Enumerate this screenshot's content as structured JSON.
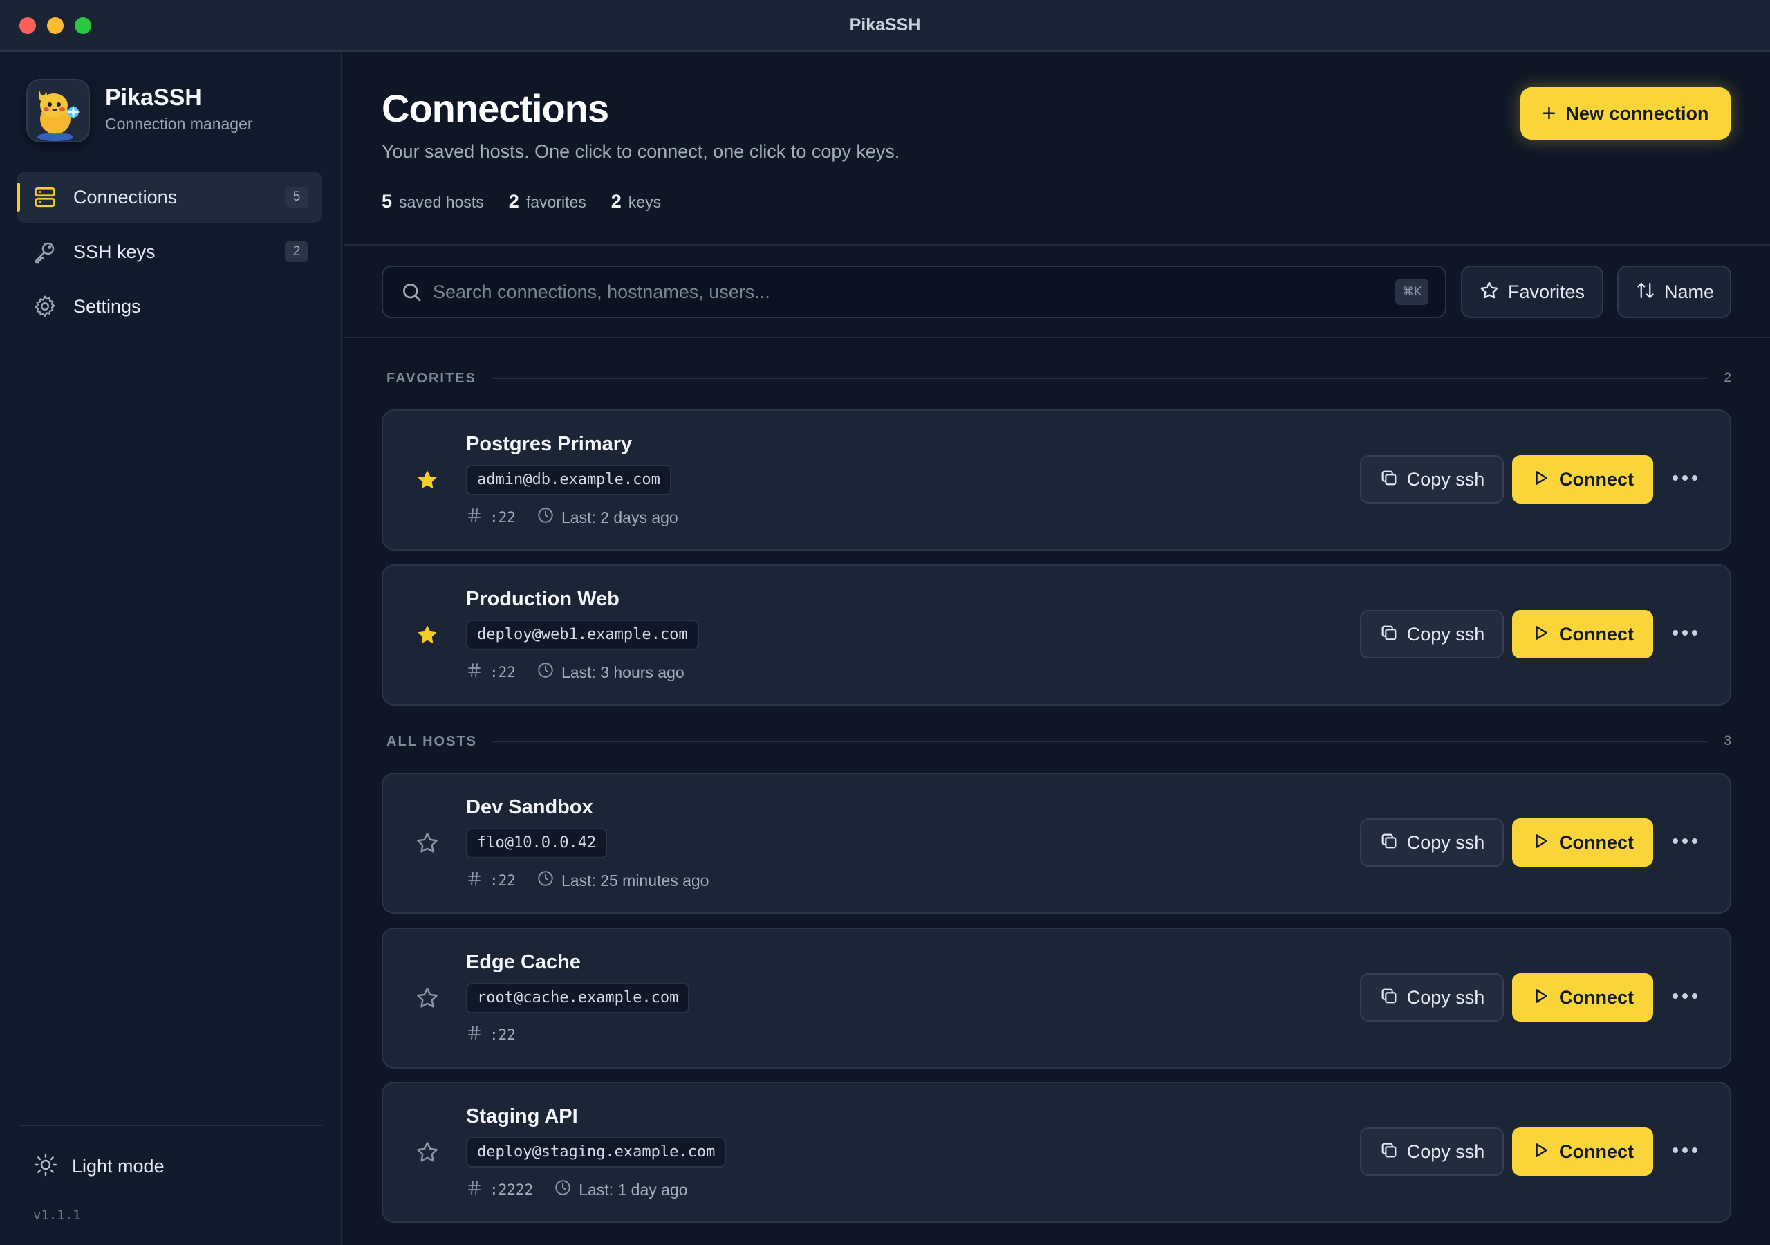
{
  "window": {
    "title": "PikaSSH"
  },
  "sidebar": {
    "app_name": "PikaSSH",
    "app_subtitle": "Connection manager",
    "logo_icon": "pikachu-mascot-icon",
    "items": [
      {
        "label": "Connections",
        "count": "5",
        "icon": "server-icon",
        "active": true
      },
      {
        "label": "SSH keys",
        "count": "2",
        "icon": "key-icon",
        "active": false
      },
      {
        "label": "Settings",
        "icon": "gear-icon",
        "active": false
      }
    ],
    "theme_toggle": "Light mode",
    "version": "v1.1.1"
  },
  "header": {
    "title": "Connections",
    "subtitle": "Your saved hosts. One click to connect, one click to copy keys.",
    "stats": [
      {
        "value": "5",
        "label": "saved hosts"
      },
      {
        "value": "2",
        "label": "favorites"
      },
      {
        "value": "2",
        "label": "keys"
      }
    ],
    "new_button": "New connection"
  },
  "toolbar": {
    "search_placeholder": "Search connections, hostnames, users...",
    "search_shortcut": "⌘K",
    "favorites_filter": "Favorites",
    "sort_label": "Name"
  },
  "sections": [
    {
      "label": "FAVORITES",
      "count": "2"
    },
    {
      "label": "ALL HOSTS",
      "count": "3"
    }
  ],
  "connections": [
    {
      "name": "Postgres Primary",
      "host": "admin@db.example.com",
      "port": ":22",
      "last": "Last: 2 days ago",
      "favorite": true,
      "copy_label": "Copy ssh",
      "connect_label": "Connect"
    },
    {
      "name": "Production Web",
      "host": "deploy@web1.example.com",
      "port": ":22",
      "last": "Last: 3 hours ago",
      "favorite": true,
      "copy_label": "Copy ssh",
      "connect_label": "Connect"
    },
    {
      "name": "Dev Sandbox",
      "host": "flo@10.0.0.42",
      "port": ":22",
      "last": "Last: 25 minutes ago",
      "favorite": false,
      "copy_label": "Copy ssh",
      "connect_label": "Connect"
    },
    {
      "name": "Edge Cache",
      "host": "root@cache.example.com",
      "port": ":22",
      "last": "",
      "favorite": false,
      "copy_label": "Copy ssh",
      "connect_label": "Connect"
    },
    {
      "name": "Staging API",
      "host": "deploy@staging.example.com",
      "port": ":2222",
      "last": "Last: 1 day ago",
      "favorite": false,
      "copy_label": "Copy ssh",
      "connect_label": "Connect"
    }
  ],
  "colors": {
    "accent": "#fad53a",
    "background": "#0f1726",
    "sidebar": "#111a2a",
    "card": "#1c2536",
    "star_filled": "#f7cd2b"
  }
}
